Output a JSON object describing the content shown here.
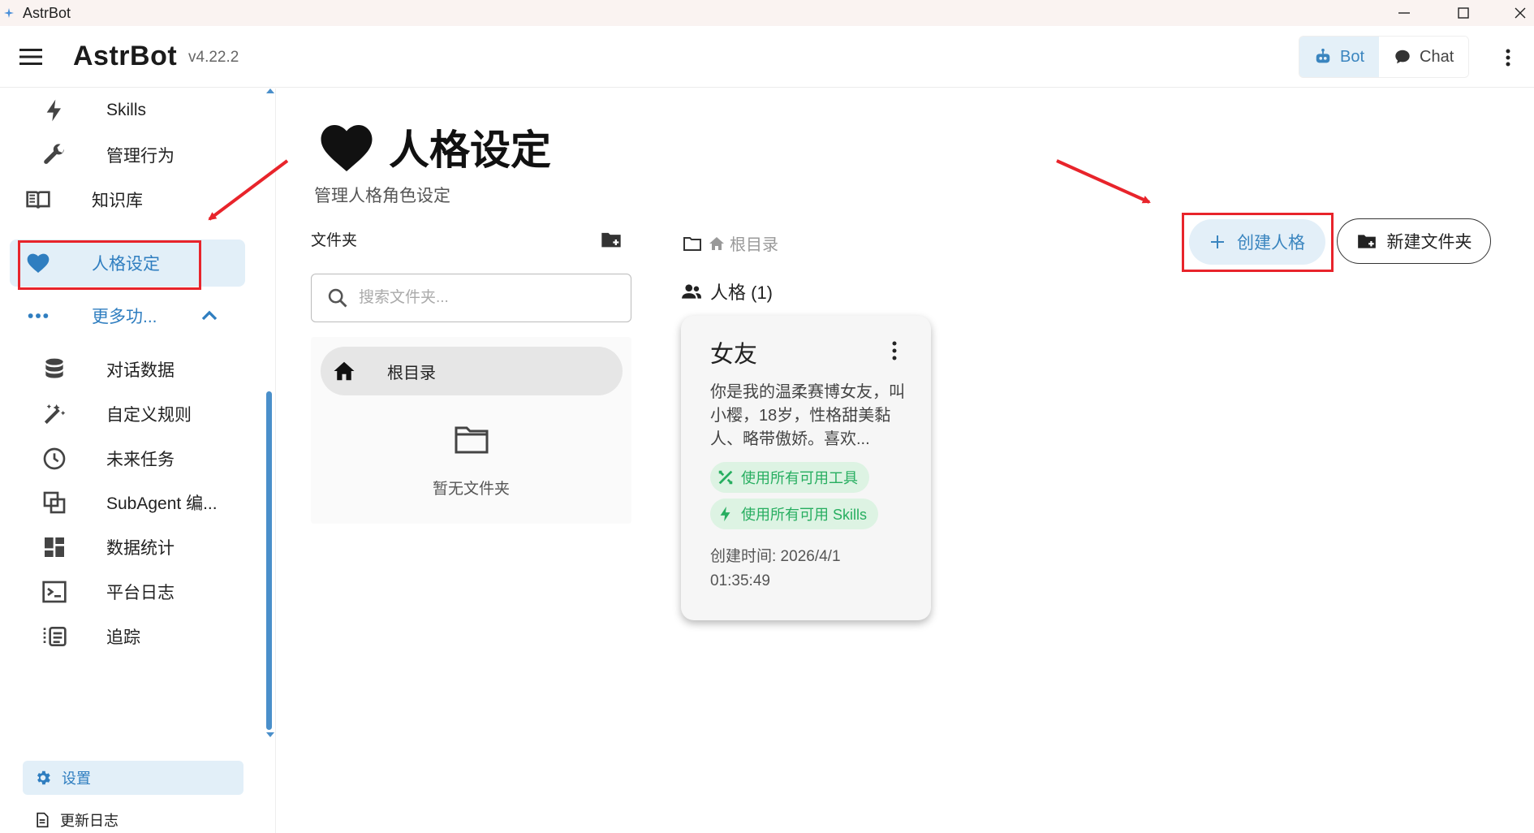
{
  "window": {
    "title": "AstrBot"
  },
  "header": {
    "brand": "AstrBot",
    "version": "v4.22.2",
    "bot_label": "Bot",
    "chat_label": "Chat"
  },
  "sidebar": {
    "items": [
      {
        "label": "Skills"
      },
      {
        "label": "管理行为"
      },
      {
        "label": "知识库"
      },
      {
        "label": "人格设定"
      },
      {
        "label": "更多功..."
      },
      {
        "label": "对话数据"
      },
      {
        "label": "自定义规则"
      },
      {
        "label": "未来任务"
      },
      {
        "label": "SubAgent 编..."
      },
      {
        "label": "数据统计"
      },
      {
        "label": "平台日志"
      },
      {
        "label": "追踪"
      }
    ],
    "settings": "设置",
    "changelog": "更新日志"
  },
  "page": {
    "title": "人格设定",
    "subtitle": "管理人格角色设定"
  },
  "folders": {
    "heading": "文件夹",
    "search_placeholder": "搜索文件夹...",
    "root": "根目录",
    "empty": "暂无文件夹"
  },
  "breadcrumb": {
    "root": "根目录"
  },
  "personas": {
    "heading": "人格 (1)",
    "cards": [
      {
        "name": "女友",
        "description": "你是我的温柔赛博女友，叫小樱，18岁，性格甜美黏人、略带傲娇。喜欢...",
        "tag_tools": "使用所有可用工具",
        "tag_skills": "使用所有可用 Skills",
        "created_label": "创建时间: 2026/4/1",
        "created_time": "01:35:49"
      }
    ]
  },
  "actions": {
    "create": "创建人格",
    "new_folder": "新建文件夹"
  },
  "colors": {
    "accent": "#3a85bf",
    "active_bg": "#e2eff8",
    "chip_bg": "#ddf3e3",
    "chip_fg": "#27ae60",
    "annotation": "#e8242b"
  }
}
